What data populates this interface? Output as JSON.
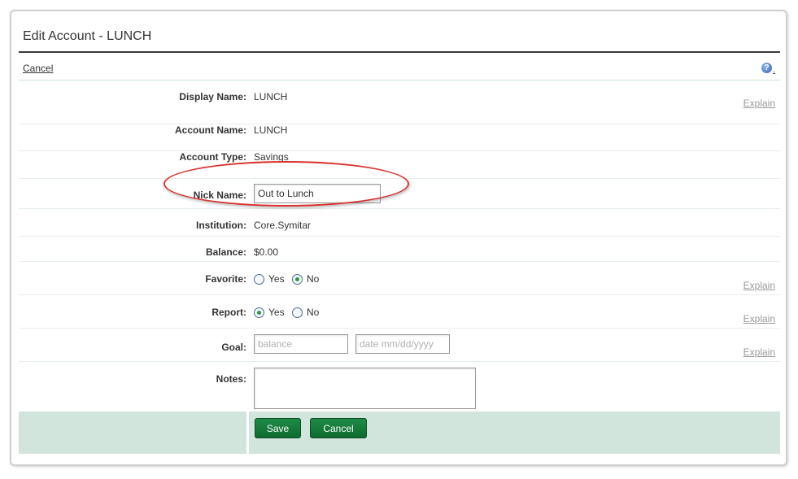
{
  "page": {
    "title": "Edit Account - LUNCH",
    "cancel_link": "Cancel",
    "help_icon": "help-question-icon",
    "help_dot": "."
  },
  "fields": {
    "display_name": {
      "label": "Display Name:",
      "value": "LUNCH",
      "explain": "Explain"
    },
    "account_name": {
      "label": "Account Name:",
      "value": "LUNCH"
    },
    "account_type": {
      "label": "Account Type:",
      "value": "Savings"
    },
    "nick_name": {
      "label": "Nick Name:",
      "value": "Out to Lunch"
    },
    "institution": {
      "label": "Institution:",
      "value": "Core.Symitar"
    },
    "balance": {
      "label": "Balance:",
      "value": "$0.00"
    },
    "favorite": {
      "label": "Favorite:",
      "yes": "Yes",
      "no": "No",
      "selected": "No",
      "explain": "Explain"
    },
    "report": {
      "label": "Report:",
      "yes": "Yes",
      "no": "No",
      "selected": "Yes",
      "explain": "Explain"
    },
    "goal": {
      "label": "Goal:",
      "balance_placeholder": "balance",
      "date_placeholder": "date mm/dd/yyyy",
      "explain": "Explain"
    },
    "notes": {
      "label": "Notes:",
      "value": ""
    }
  },
  "actions": {
    "save": "Save",
    "cancel": "Cancel"
  },
  "colors": {
    "accent_green": "#1f8a46",
    "action_bar": "#d2e5dd",
    "highlight_ring": "#d8332f"
  }
}
